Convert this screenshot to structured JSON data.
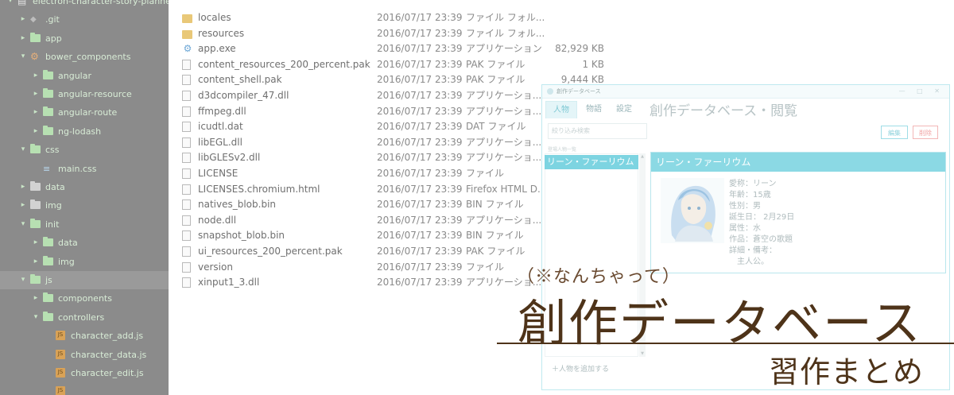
{
  "tree": {
    "rows": [
      {
        "label": "electron-character-story-planner",
        "icon": "repo-icon",
        "arrow": "▾",
        "indent": 0
      },
      {
        "label": ".git",
        "icon": "git-icon",
        "arrow": "▸",
        "indent": 1
      },
      {
        "label": "app",
        "icon": "folder-icon",
        "arrow": "▸",
        "indent": 1
      },
      {
        "label": "bower_components",
        "icon": "bower-icon",
        "arrow": "▾",
        "indent": 1
      },
      {
        "label": "angular",
        "icon": "folder-icon",
        "arrow": "▸",
        "indent": 2
      },
      {
        "label": "angular-resource",
        "icon": "folder-icon",
        "arrow": "▸",
        "indent": 2
      },
      {
        "label": "angular-route",
        "icon": "folder-icon",
        "arrow": "▸",
        "indent": 2
      },
      {
        "label": "ng-lodash",
        "icon": "folder-icon",
        "arrow": "▸",
        "indent": 2
      },
      {
        "label": "css",
        "icon": "folder-icon",
        "arrow": "▾",
        "indent": 1
      },
      {
        "label": "main.css",
        "icon": "css-file-icon",
        "arrow": "",
        "indent": 2
      },
      {
        "label": "data",
        "icon": "folder-grey-icon",
        "arrow": "▸",
        "indent": 1
      },
      {
        "label": "img",
        "icon": "folder-grey-icon",
        "arrow": "▸",
        "indent": 1
      },
      {
        "label": "init",
        "icon": "folder-icon",
        "arrow": "▾",
        "indent": 1
      },
      {
        "label": "data",
        "icon": "folder-icon",
        "arrow": "▸",
        "indent": 2
      },
      {
        "label": "img",
        "icon": "folder-icon",
        "arrow": "▸",
        "indent": 2
      },
      {
        "label": "js",
        "icon": "folder-icon",
        "arrow": "▾",
        "indent": 1,
        "selected": true
      },
      {
        "label": "components",
        "icon": "folder-icon",
        "arrow": "▸",
        "indent": 2
      },
      {
        "label": "controllers",
        "icon": "folder-icon",
        "arrow": "▾",
        "indent": 2
      },
      {
        "label": "character_add.js",
        "icon": "js-file-icon",
        "arrow": "",
        "indent": 3
      },
      {
        "label": "character_data.js",
        "icon": "js-file-icon",
        "arrow": "",
        "indent": 3
      },
      {
        "label": "character_edit.js",
        "icon": "js-file-icon",
        "arrow": "",
        "indent": 3
      },
      {
        "label": "",
        "icon": "js-file-icon",
        "arrow": "",
        "indent": 3
      }
    ]
  },
  "files": [
    {
      "name": "locales",
      "date": "2016/07/17 23:39",
      "type": "ファイル フォル...",
      "size": "",
      "icon": "folder-icon"
    },
    {
      "name": "resources",
      "date": "2016/07/17 23:39",
      "type": "ファイル フォル...",
      "size": "",
      "icon": "folder-icon"
    },
    {
      "name": "app.exe",
      "date": "2016/07/17 23:39",
      "type": "アプリケーション",
      "size": "82,929 KB",
      "icon": "exe-icon"
    },
    {
      "name": "content_resources_200_percent.pak",
      "date": "2016/07/17 23:39",
      "type": "PAK ファイル",
      "size": "1 KB",
      "icon": "file-icon"
    },
    {
      "name": "content_shell.pak",
      "date": "2016/07/17 23:39",
      "type": "PAK ファイル",
      "size": "9,444 KB",
      "icon": "file-icon"
    },
    {
      "name": "d3dcompiler_47.dll",
      "date": "2016/07/17 23:39",
      "type": "アプリケーショ...",
      "size": "",
      "icon": "dll-icon"
    },
    {
      "name": "ffmpeg.dll",
      "date": "2016/07/17 23:39",
      "type": "アプリケーショ...",
      "size": "",
      "icon": "dll-icon"
    },
    {
      "name": "icudtl.dat",
      "date": "2016/07/17 23:39",
      "type": "DAT ファイル",
      "size": "",
      "icon": "file-icon"
    },
    {
      "name": "libEGL.dll",
      "date": "2016/07/17 23:39",
      "type": "アプリケーショ...",
      "size": "",
      "icon": "dll-icon"
    },
    {
      "name": "libGLESv2.dll",
      "date": "2016/07/17 23:39",
      "type": "アプリケーショ...",
      "size": "",
      "icon": "dll-icon"
    },
    {
      "name": "LICENSE",
      "date": "2016/07/17 23:39",
      "type": "ファイル",
      "size": "",
      "icon": "file-icon"
    },
    {
      "name": "LICENSES.chromium.html",
      "date": "2016/07/17 23:39",
      "type": "Firefox HTML D...",
      "size": "",
      "icon": "html-icon"
    },
    {
      "name": "natives_blob.bin",
      "date": "2016/07/17 23:39",
      "type": "BIN ファイル",
      "size": "",
      "icon": "file-icon"
    },
    {
      "name": "node.dll",
      "date": "2016/07/17 23:39",
      "type": "アプリケーショ...",
      "size": "",
      "icon": "dll-icon"
    },
    {
      "name": "snapshot_blob.bin",
      "date": "2016/07/17 23:39",
      "type": "BIN ファイル",
      "size": "",
      "icon": "file-icon"
    },
    {
      "name": "ui_resources_200_percent.pak",
      "date": "2016/07/17 23:39",
      "type": "PAK ファイル",
      "size": "",
      "icon": "file-icon"
    },
    {
      "name": "version",
      "date": "2016/07/17 23:39",
      "type": "ファイル",
      "size": "",
      "icon": "file-icon"
    },
    {
      "name": "xinput1_3.dll",
      "date": "2016/07/17 23:39",
      "type": "アプリケーショ...",
      "size": "",
      "icon": "dll-icon"
    }
  ],
  "app": {
    "window_title": "創作データベース",
    "tabs": [
      "人物",
      "物語",
      "設定"
    ],
    "active_tab": 0,
    "page_title": "創作データベース・閲覧",
    "search_placeholder": "絞り込み検索",
    "list_header": "登場人物一覧",
    "list_items": [
      "リーン・ファーリウム"
    ],
    "add_label": "＋人物を追加する",
    "edit_label": "編集",
    "delete_label": "削除",
    "card": {
      "name": "リーン・ファーリウム",
      "details": [
        "愛称：リーン",
        "年齢：15歳",
        "性別：男",
        "誕生日： 2月29日",
        "属性：水",
        "作品：蒼空の歌題",
        "詳細・備考：",
        "　主人公。"
      ]
    },
    "accent": "#7dd4e1"
  },
  "overlay": {
    "subtitle": "（※なんちゃって）",
    "title": "創作データベース",
    "tagline": "習作まとめ"
  }
}
